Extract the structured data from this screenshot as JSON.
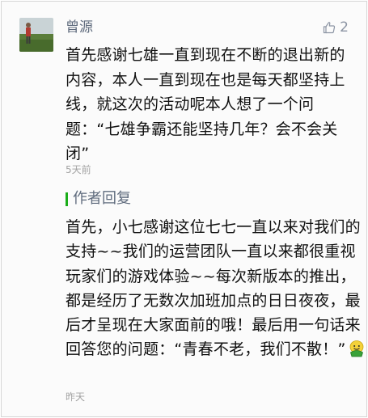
{
  "comment": {
    "author": "曾源",
    "like_count": "2",
    "text": "首先感谢七雄一直到现在不断的退出新的内容，本人一直到现在也是每天都坚持上线，就这次的活动呢本人想了一个问题：“七雄争霸还能坚持几年？会不会关闭”",
    "time": "5天前",
    "icons": {
      "like": "thumbs-up-icon",
      "avatar": "user-avatar-photo"
    }
  },
  "reply": {
    "label": "作者回复",
    "text": "首先，小七感谢这位七七一直以来对我们的支持~~我们的运营团队一直以来都很重视玩家们的游戏体验~~每次新版本的推出，都是经历了无数次加班加点的日日夜夜，最后才呈现在大家面前的哦！最后用一句话来回答您的问题：“青春不老，我们不散！”",
    "emoji": "smiley-face-icon",
    "time": "昨天",
    "accent_color": "#1aad19"
  }
}
